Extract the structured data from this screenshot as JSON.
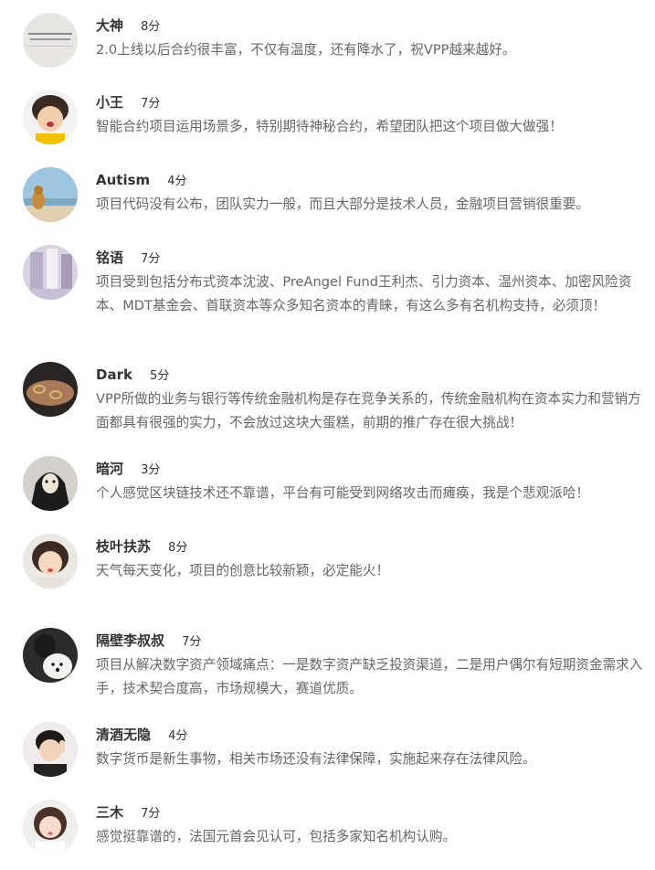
{
  "comments": [
    {
      "name": "大神",
      "score": "8分",
      "text": "2.0上线以后合约很丰富，不仅有温度，还有降水了，祝VPP越来越好。",
      "avatar_icon": "avatar-image"
    },
    {
      "name": "小王",
      "score": "7分",
      "text": "智能合约项目运用场景多，特别期待神秘合约，希望团队把这个项目做大做强！",
      "avatar_icon": "avatar-image"
    },
    {
      "name": "Autism",
      "score": "4分",
      "text": "项目代码没有公布，团队实力一般，而且大部分是技术人员，金融项目营销很重要。",
      "avatar_icon": "avatar-image"
    },
    {
      "name": "铭语",
      "score": "7分",
      "text": "项目受到包括分布式资本沈波、PreAngel Fund王利杰、引力资本、温州资本、加密风险资本、MDT基金会、首联资本等众多知名资本的青睐，有这么多有名机构支持，必须顶！",
      "avatar_icon": "avatar-image"
    },
    {
      "name": "Dark",
      "score": "5分",
      "text": "VPP所做的业务与银行等传统金融机构是存在竞争关系的，传统金融机构在资本实力和营销方面都具有很强的实力，不会放过这块大蛋糕，前期的推广存在很大挑战！",
      "avatar_icon": "avatar-image"
    },
    {
      "name": "暗河",
      "score": "3分",
      "text": "个人感觉区块链技术还不靠谱，平台有可能受到网络攻击而瘫痪，我是个悲观派哈！",
      "avatar_icon": "avatar-image"
    },
    {
      "name": "枝叶扶苏",
      "score": "8分",
      "text": "天气每天变化，项目的创意比较新颖，必定能火！",
      "avatar_icon": "avatar-image"
    },
    {
      "name": "隔壁李叔叔",
      "score": "7分",
      "text": "项目从解决数字资产领域痛点：一是数字资产缺乏投资渠道，二是用户偶尔有短期资金需求入手，技术契合度高，市场规模大，赛道优质。",
      "avatar_icon": "avatar-image"
    },
    {
      "name": "清酒无隐",
      "score": "4分",
      "text": "数字货币是新生事物，相关市场还没有法律保障，实施起来存在法律风险。",
      "avatar_icon": "avatar-image"
    },
    {
      "name": "三木",
      "score": "7分",
      "text": "感觉挺靠谱的，法国元首会见认可，包括多家知名机构认购。",
      "avatar_icon": "avatar-image"
    }
  ]
}
